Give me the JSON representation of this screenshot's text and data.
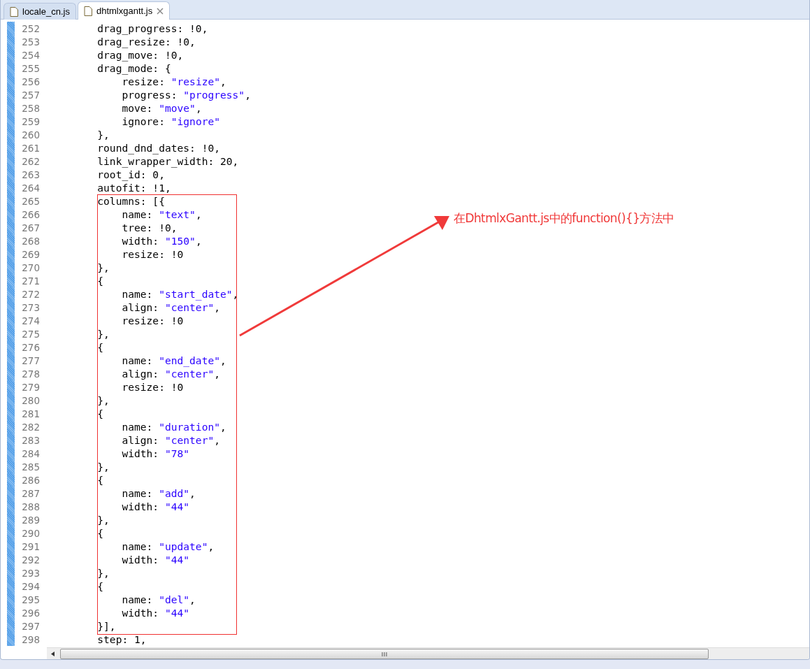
{
  "tabs": [
    {
      "label": "locale_cn.js",
      "selected": false,
      "closable": false
    },
    {
      "label": "dhtmlxgantt.js",
      "selected": true,
      "closable": true
    }
  ],
  "editor": {
    "lines": [
      {
        "number": "252",
        "segments": [
          {
            "kind": "code",
            "text": "        drag_progress: !0,"
          }
        ]
      },
      {
        "number": "253",
        "segments": [
          {
            "kind": "code",
            "text": "        drag_resize: !0,"
          }
        ]
      },
      {
        "number": "254",
        "segments": [
          {
            "kind": "code",
            "text": "        drag_move: !0,"
          }
        ]
      },
      {
        "number": "255",
        "segments": [
          {
            "kind": "code",
            "text": "        drag_mode: {"
          }
        ]
      },
      {
        "number": "256",
        "segments": [
          {
            "kind": "code",
            "text": "            resize: "
          },
          {
            "kind": "string",
            "text": "\"resize\""
          },
          {
            "kind": "code",
            "text": ","
          }
        ]
      },
      {
        "number": "257",
        "segments": [
          {
            "kind": "code",
            "text": "            progress: "
          },
          {
            "kind": "string",
            "text": "\"progress\""
          },
          {
            "kind": "code",
            "text": ","
          }
        ]
      },
      {
        "number": "258",
        "segments": [
          {
            "kind": "code",
            "text": "            move: "
          },
          {
            "kind": "string",
            "text": "\"move\""
          },
          {
            "kind": "code",
            "text": ","
          }
        ]
      },
      {
        "number": "259",
        "segments": [
          {
            "kind": "code",
            "text": "            ignore: "
          },
          {
            "kind": "string",
            "text": "\"ignore\""
          }
        ]
      },
      {
        "number": "260",
        "segments": [
          {
            "kind": "code",
            "text": "        },"
          }
        ]
      },
      {
        "number": "261",
        "segments": [
          {
            "kind": "code",
            "text": "        round_dnd_dates: !0,"
          }
        ]
      },
      {
        "number": "262",
        "segments": [
          {
            "kind": "code",
            "text": "        link_wrapper_width: 20,"
          }
        ]
      },
      {
        "number": "263",
        "segments": [
          {
            "kind": "code",
            "text": "        root_id: 0,"
          }
        ]
      },
      {
        "number": "264",
        "segments": [
          {
            "kind": "code",
            "text": "        autofit: !1,"
          }
        ]
      },
      {
        "number": "265",
        "segments": [
          {
            "kind": "code",
            "text": "        columns: [{"
          }
        ]
      },
      {
        "number": "266",
        "segments": [
          {
            "kind": "code",
            "text": "            name: "
          },
          {
            "kind": "string",
            "text": "\"text\""
          },
          {
            "kind": "code",
            "text": ","
          }
        ]
      },
      {
        "number": "267",
        "segments": [
          {
            "kind": "code",
            "text": "            tree: !0,"
          }
        ]
      },
      {
        "number": "268",
        "segments": [
          {
            "kind": "code",
            "text": "            width: "
          },
          {
            "kind": "string",
            "text": "\"150\""
          },
          {
            "kind": "code",
            "text": ","
          }
        ]
      },
      {
        "number": "269",
        "segments": [
          {
            "kind": "code",
            "text": "            resize: !0"
          }
        ]
      },
      {
        "number": "270",
        "segments": [
          {
            "kind": "code",
            "text": "        },"
          }
        ]
      },
      {
        "number": "271",
        "segments": [
          {
            "kind": "code",
            "text": "        {"
          }
        ]
      },
      {
        "number": "272",
        "segments": [
          {
            "kind": "code",
            "text": "            name: "
          },
          {
            "kind": "string",
            "text": "\"start_date\""
          },
          {
            "kind": "code",
            "text": ","
          }
        ]
      },
      {
        "number": "273",
        "segments": [
          {
            "kind": "code",
            "text": "            align: "
          },
          {
            "kind": "string",
            "text": "\"center\""
          },
          {
            "kind": "code",
            "text": ","
          }
        ]
      },
      {
        "number": "274",
        "segments": [
          {
            "kind": "code",
            "text": "            resize: !0"
          }
        ]
      },
      {
        "number": "275",
        "segments": [
          {
            "kind": "code",
            "text": "        },"
          }
        ]
      },
      {
        "number": "276",
        "segments": [
          {
            "kind": "code",
            "text": "        {"
          }
        ]
      },
      {
        "number": "277",
        "segments": [
          {
            "kind": "code",
            "text": "            name: "
          },
          {
            "kind": "string",
            "text": "\"end_date\""
          },
          {
            "kind": "code",
            "text": ","
          }
        ]
      },
      {
        "number": "278",
        "segments": [
          {
            "kind": "code",
            "text": "            align: "
          },
          {
            "kind": "string",
            "text": "\"center\""
          },
          {
            "kind": "code",
            "text": ","
          }
        ]
      },
      {
        "number": "279",
        "segments": [
          {
            "kind": "code",
            "text": "            resize: !0"
          }
        ]
      },
      {
        "number": "280",
        "segments": [
          {
            "kind": "code",
            "text": "        },"
          }
        ]
      },
      {
        "number": "281",
        "segments": [
          {
            "kind": "code",
            "text": "        {"
          }
        ]
      },
      {
        "number": "282",
        "segments": [
          {
            "kind": "code",
            "text": "            name: "
          },
          {
            "kind": "string",
            "text": "\"duration\""
          },
          {
            "kind": "code",
            "text": ","
          }
        ]
      },
      {
        "number": "283",
        "segments": [
          {
            "kind": "code",
            "text": "            align: "
          },
          {
            "kind": "string",
            "text": "\"center\""
          },
          {
            "kind": "code",
            "text": ","
          }
        ]
      },
      {
        "number": "284",
        "segments": [
          {
            "kind": "code",
            "text": "            width: "
          },
          {
            "kind": "string",
            "text": "\"78\""
          }
        ]
      },
      {
        "number": "285",
        "segments": [
          {
            "kind": "code",
            "text": "        },"
          }
        ]
      },
      {
        "number": "286",
        "segments": [
          {
            "kind": "code",
            "text": "        {"
          }
        ]
      },
      {
        "number": "287",
        "segments": [
          {
            "kind": "code",
            "text": "            name: "
          },
          {
            "kind": "string",
            "text": "\"add\""
          },
          {
            "kind": "code",
            "text": ","
          }
        ]
      },
      {
        "number": "288",
        "segments": [
          {
            "kind": "code",
            "text": "            width: "
          },
          {
            "kind": "string",
            "text": "\"44\""
          }
        ]
      },
      {
        "number": "289",
        "segments": [
          {
            "kind": "code",
            "text": "        },"
          }
        ]
      },
      {
        "number": "290",
        "segments": [
          {
            "kind": "code",
            "text": "        {"
          }
        ]
      },
      {
        "number": "291",
        "segments": [
          {
            "kind": "code",
            "text": "            name: "
          },
          {
            "kind": "string",
            "text": "\"update\""
          },
          {
            "kind": "code",
            "text": ","
          }
        ]
      },
      {
        "number": "292",
        "segments": [
          {
            "kind": "code",
            "text": "            width: "
          },
          {
            "kind": "string",
            "text": "\"44\""
          }
        ]
      },
      {
        "number": "293",
        "segments": [
          {
            "kind": "code",
            "text": "        },"
          }
        ]
      },
      {
        "number": "294",
        "segments": [
          {
            "kind": "code",
            "text": "        {"
          }
        ]
      },
      {
        "number": "295",
        "segments": [
          {
            "kind": "code",
            "text": "            name: "
          },
          {
            "kind": "string",
            "text": "\"del\""
          },
          {
            "kind": "code",
            "text": ","
          }
        ]
      },
      {
        "number": "296",
        "segments": [
          {
            "kind": "code",
            "text": "            width: "
          },
          {
            "kind": "string",
            "text": "\"44\""
          }
        ]
      },
      {
        "number": "297",
        "segments": [
          {
            "kind": "code",
            "text": "        }],"
          }
        ]
      },
      {
        "number": "298",
        "segments": [
          {
            "kind": "code",
            "text": "        step: 1,"
          }
        ]
      }
    ]
  },
  "annotation": {
    "text": "在DhtmlxGantt.js中的function(){}方法中"
  }
}
